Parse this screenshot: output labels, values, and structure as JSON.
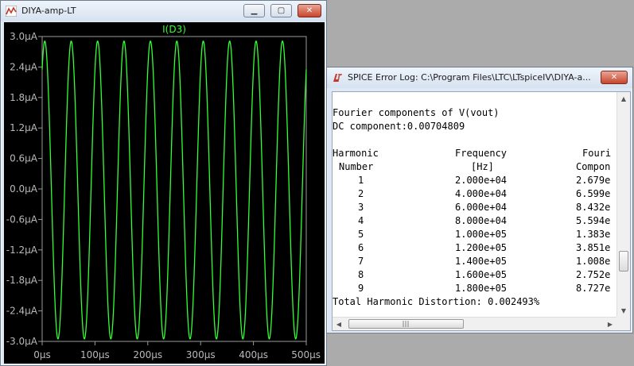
{
  "plot_window": {
    "title": "DIYA-amp-LT",
    "buttons": {
      "minimize": "▁",
      "maximize": "▢",
      "close": "✕"
    }
  },
  "chart_data": {
    "type": "line",
    "trace_name": "I(D3)",
    "trace_color": "#33ff33",
    "background": "#000000",
    "x_unit": "µs",
    "y_unit": "µA",
    "xlim": [
      0,
      500
    ],
    "ylim": [
      -3.0,
      3.0
    ],
    "x_ticks": [
      "0µs",
      "100µs",
      "200µs",
      "300µs",
      "400µs",
      "500µs"
    ],
    "x_tick_values": [
      0,
      100,
      200,
      300,
      400,
      500
    ],
    "y_ticks": [
      "3.0µA",
      "2.4µA",
      "1.8µA",
      "1.2µA",
      "0.6µA",
      "0.0µA",
      "-0.6µA",
      "-1.2µA",
      "-1.8µA",
      "-2.4µA",
      "-3.0µA"
    ],
    "y_tick_values": [
      3.0,
      2.4,
      1.8,
      1.2,
      0.6,
      0.0,
      -0.6,
      -1.2,
      -1.8,
      -2.4,
      -3.0
    ],
    "series": [
      {
        "frequency_hz": 20000,
        "amplitude_uA": 2.93,
        "offset_uA": -0.02,
        "phase_deg": 54
      }
    ]
  },
  "log_window": {
    "title": "SPICE Error Log: C:\\Program Files\\LTC\\LTspiceIV\\DIYA-a...",
    "buttons": {
      "close": "✕"
    },
    "heading": "Fourier components of V(vout)",
    "dc": "DC component:0.00704809",
    "col_harmonic_1": "Harmonic",
    "col_harmonic_2": "Number",
    "col_freq_1": "Frequency",
    "col_freq_2": "[Hz]",
    "col_comp_1": "Fouri",
    "col_comp_2": "Compon",
    "rows": [
      {
        "n": "1",
        "freq": "2.000e+04",
        "comp": "2.679e"
      },
      {
        "n": "2",
        "freq": "4.000e+04",
        "comp": "6.599e"
      },
      {
        "n": "3",
        "freq": "6.000e+04",
        "comp": "8.432e"
      },
      {
        "n": "4",
        "freq": "8.000e+04",
        "comp": "5.594e"
      },
      {
        "n": "5",
        "freq": "1.000e+05",
        "comp": "1.383e"
      },
      {
        "n": "6",
        "freq": "1.200e+05",
        "comp": "3.851e"
      },
      {
        "n": "7",
        "freq": "1.400e+05",
        "comp": "1.008e"
      },
      {
        "n": "8",
        "freq": "1.600e+05",
        "comp": "2.752e"
      },
      {
        "n": "9",
        "freq": "1.800e+05",
        "comp": "8.727e"
      }
    ],
    "thd": "Total Harmonic Distortion: 0.002493%",
    "scroll": {
      "up": "▲",
      "down": "▼",
      "left": "◀",
      "right": "▶"
    }
  }
}
